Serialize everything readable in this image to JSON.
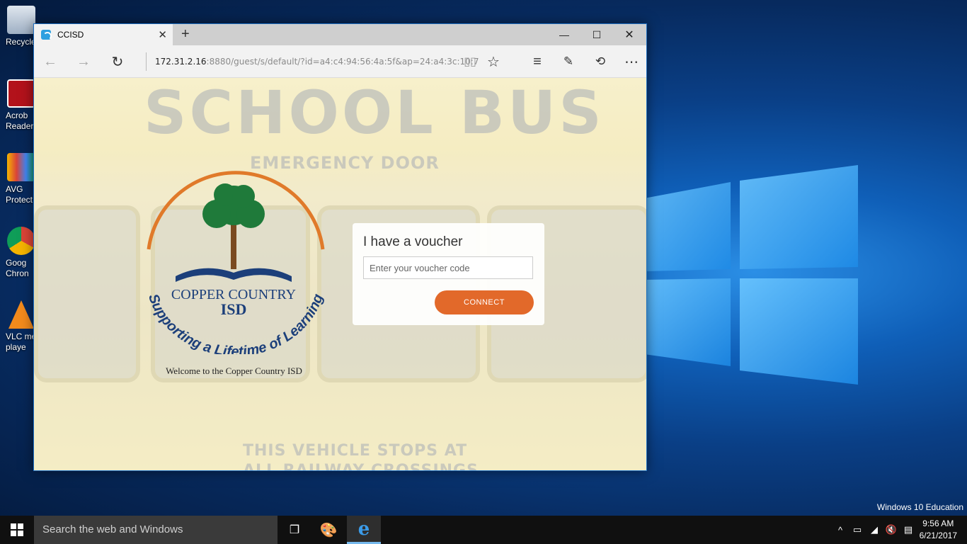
{
  "desktop": {
    "icons": [
      {
        "label": "Recycle"
      },
      {
        "label": "Acrob Reader"
      },
      {
        "label": "AVG Protect"
      },
      {
        "label": "Goog Chron"
      },
      {
        "label": "VLC me playe"
      }
    ],
    "edition": "Windows 10 Education"
  },
  "browser": {
    "tab_title": "CCISD",
    "url_host": "172.31.2.16",
    "url_rest": ":8880/guest/s/default/?id=a4:c4:94:56:4a:5f&ap=24:a4:3c:10:7"
  },
  "page": {
    "bus_title": "SCHOOL BUS",
    "bus_subtitle": "EMERGENCY DOOR",
    "bus_bottom_line1": "THIS VEHICLE STOPS AT",
    "bus_bottom_line2": "ALL RAILWAY CROSSINGS",
    "logo_name_line1": "COPPER COUNTRY",
    "logo_name_line2": "ISD",
    "logo_tagline": "Supporting a Lifetime of Learning",
    "welcome": "Welcome to the Copper Country ISD",
    "voucher_title": "I have a voucher",
    "voucher_placeholder": "Enter your voucher code",
    "connect_label": "CONNECT"
  },
  "taskbar": {
    "search_placeholder": "Search the web and Windows",
    "time": "9:56 AM",
    "date": "6/21/2017"
  },
  "colors": {
    "accent_orange": "#e2692a",
    "logo_green": "#1f7a3a",
    "logo_blue": "#1c3f7a"
  }
}
